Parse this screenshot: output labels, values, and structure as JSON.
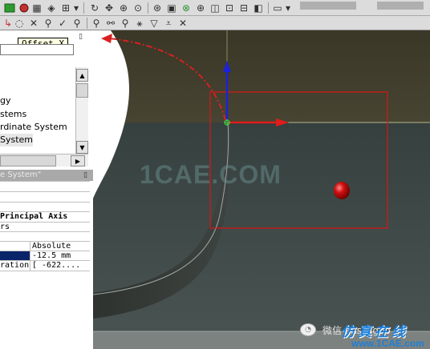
{
  "tooltip": {
    "text": "Offset X"
  },
  "tree": {
    "items": [
      "gy",
      "stems",
      "rdinate System",
      " System"
    ],
    "selected_index": 3
  },
  "details": {
    "title": "e System\"",
    "rows": [
      {
        "label": "Principal Axis"
      },
      {
        "label": "rs"
      },
      {
        "label": "",
        "value": "Absolute"
      },
      {
        "label": "",
        "value": "-12.5 mm"
      },
      {
        "label": "ration",
        "value": "[  -622...."
      }
    ]
  },
  "viewport": {
    "watermark": "1CAE.COM",
    "wechat_label": "微信",
    "wechat_id": "ansysgoo",
    "brand_cn": "仿真在线",
    "brand_site": "www.1CAE.com"
  },
  "icons": {
    "toolbar_top": [
      "icon-a",
      "icon-b",
      "undo-icon",
      "move-icon",
      "rotate-icon",
      "zoom-in-icon",
      "zoom-box-icon",
      "zoom-fit-icon",
      "zoom-icon",
      "previous-view-icon",
      "next-view-icon",
      "window-icon"
    ],
    "toolbar_second": [
      "select-arrow-icon",
      "point-icon",
      "edge-icon",
      "face-icon",
      "body-icon",
      "vertex-icon",
      "filter-icon",
      "close-x-icon"
    ]
  },
  "colors": {
    "toolbar": "#dcdcdc",
    "viewport_top": "#3e3c2a",
    "viewport_bottom": "#3b4644",
    "selection_box": "#d11818",
    "x_axis": "#e01c1c",
    "y_axis": "#1c22d8",
    "brand": "#1e7fd8"
  }
}
